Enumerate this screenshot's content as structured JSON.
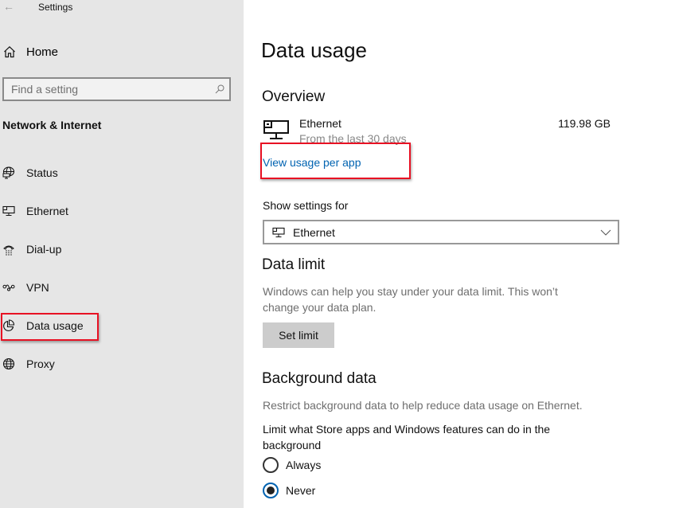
{
  "window": {
    "title": "Settings",
    "back_label": "←"
  },
  "sidebar": {
    "home_label": "Home",
    "search_placeholder": "Find a setting",
    "section_title": "Network & Internet",
    "items": [
      {
        "label": "Status",
        "icon": "status-globe-icon"
      },
      {
        "label": "Ethernet",
        "icon": "ethernet-icon"
      },
      {
        "label": "Dial-up",
        "icon": "dial-up-icon"
      },
      {
        "label": "VPN",
        "icon": "vpn-icon"
      },
      {
        "label": "Data usage",
        "icon": "data-usage-icon",
        "selected": true
      },
      {
        "label": "Proxy",
        "icon": "proxy-globe-icon"
      }
    ]
  },
  "main": {
    "page_title": "Data usage",
    "overview": {
      "heading": "Overview",
      "connection_name": "Ethernet",
      "period": "From the last 30 days",
      "amount": "119.98 GB",
      "view_usage_link": "View usage per app"
    },
    "show_settings_for": {
      "label": "Show settings for",
      "selected": "Ethernet"
    },
    "data_limit": {
      "heading": "Data limit",
      "description": "Windows can help you stay under your data limit. This won’t change your data plan.",
      "button_label": "Set limit"
    },
    "background_data": {
      "heading": "Background data",
      "description": "Restrict background data to help reduce data usage on Ethernet.",
      "question": "Limit what Store apps and Windows features can do in the background",
      "options": [
        {
          "label": "Always",
          "checked": false
        },
        {
          "label": "Never",
          "checked": true
        }
      ]
    }
  },
  "colors": {
    "sidebar_bg": "#e6e6e6",
    "accent": "#0063b1",
    "highlight": "#e81123"
  }
}
